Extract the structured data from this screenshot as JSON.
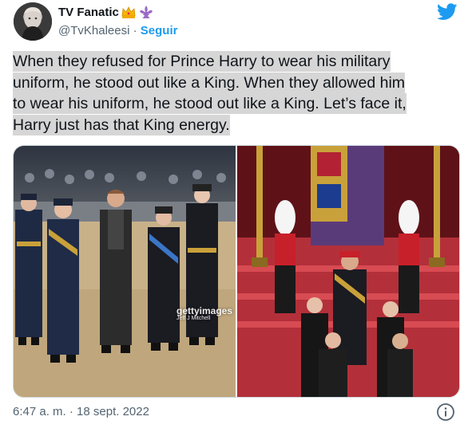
{
  "author": {
    "display_name": "TV Fanatic",
    "handle": "@TvKhaleesi",
    "separator": "·",
    "follow_label": "Seguir",
    "emojis": [
      "crown-emoji",
      "fleur-de-lis-emoji"
    ]
  },
  "tweet": {
    "lines": [
      "When they refused for Prince Harry to wear his military",
      "uniform, he stood out like a King. When they allowed him",
      "to wear his uniform, he stood out like a King. Let’s face it,",
      "Harry just has that King energy."
    ]
  },
  "media": {
    "watermark_brand": "gettyimages",
    "watermark_credit": "Jeff J Mitchell"
  },
  "footer": {
    "timestamp": "6:47 a. m. · 18 sept. 2022"
  },
  "icons": {
    "logo": "twitter-bird-icon",
    "info": "info-icon"
  },
  "colors": {
    "accent": "#1d9bf0",
    "secondary_text": "#536471",
    "highlight": "#d6d6d6"
  }
}
